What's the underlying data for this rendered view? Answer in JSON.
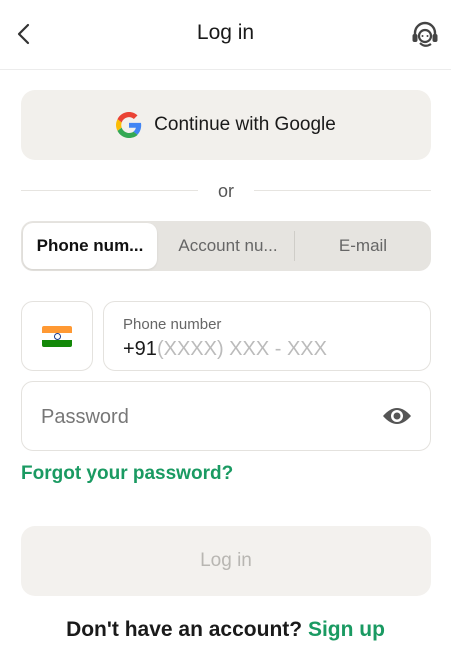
{
  "header": {
    "title": "Log in",
    "back_icon": "chevron-left-icon",
    "support_icon": "headset-support-icon"
  },
  "google": {
    "label": "Continue with Google",
    "icon": "google-logo-icon"
  },
  "divider": {
    "text": "or"
  },
  "tabs": [
    {
      "label": "Phone num...",
      "active": true
    },
    {
      "label": "Account nu...",
      "active": false
    },
    {
      "label": "E-mail",
      "active": false
    }
  ],
  "phone": {
    "country_flag": "india-flag-icon",
    "label": "Phone number",
    "code": "+91",
    "placeholder": "(XXXX) XXX - XXX"
  },
  "password": {
    "placeholder": "Password",
    "toggle_icon": "eye-icon"
  },
  "forgot": "Forgot your password?",
  "login_button": "Log in",
  "signup": {
    "prompt": "Don't have an account?",
    "link": "Sign up"
  },
  "colors": {
    "accent": "#1a9a62",
    "disabled_text": "#b8b6b2",
    "button_bg": "#f2f0ec"
  }
}
